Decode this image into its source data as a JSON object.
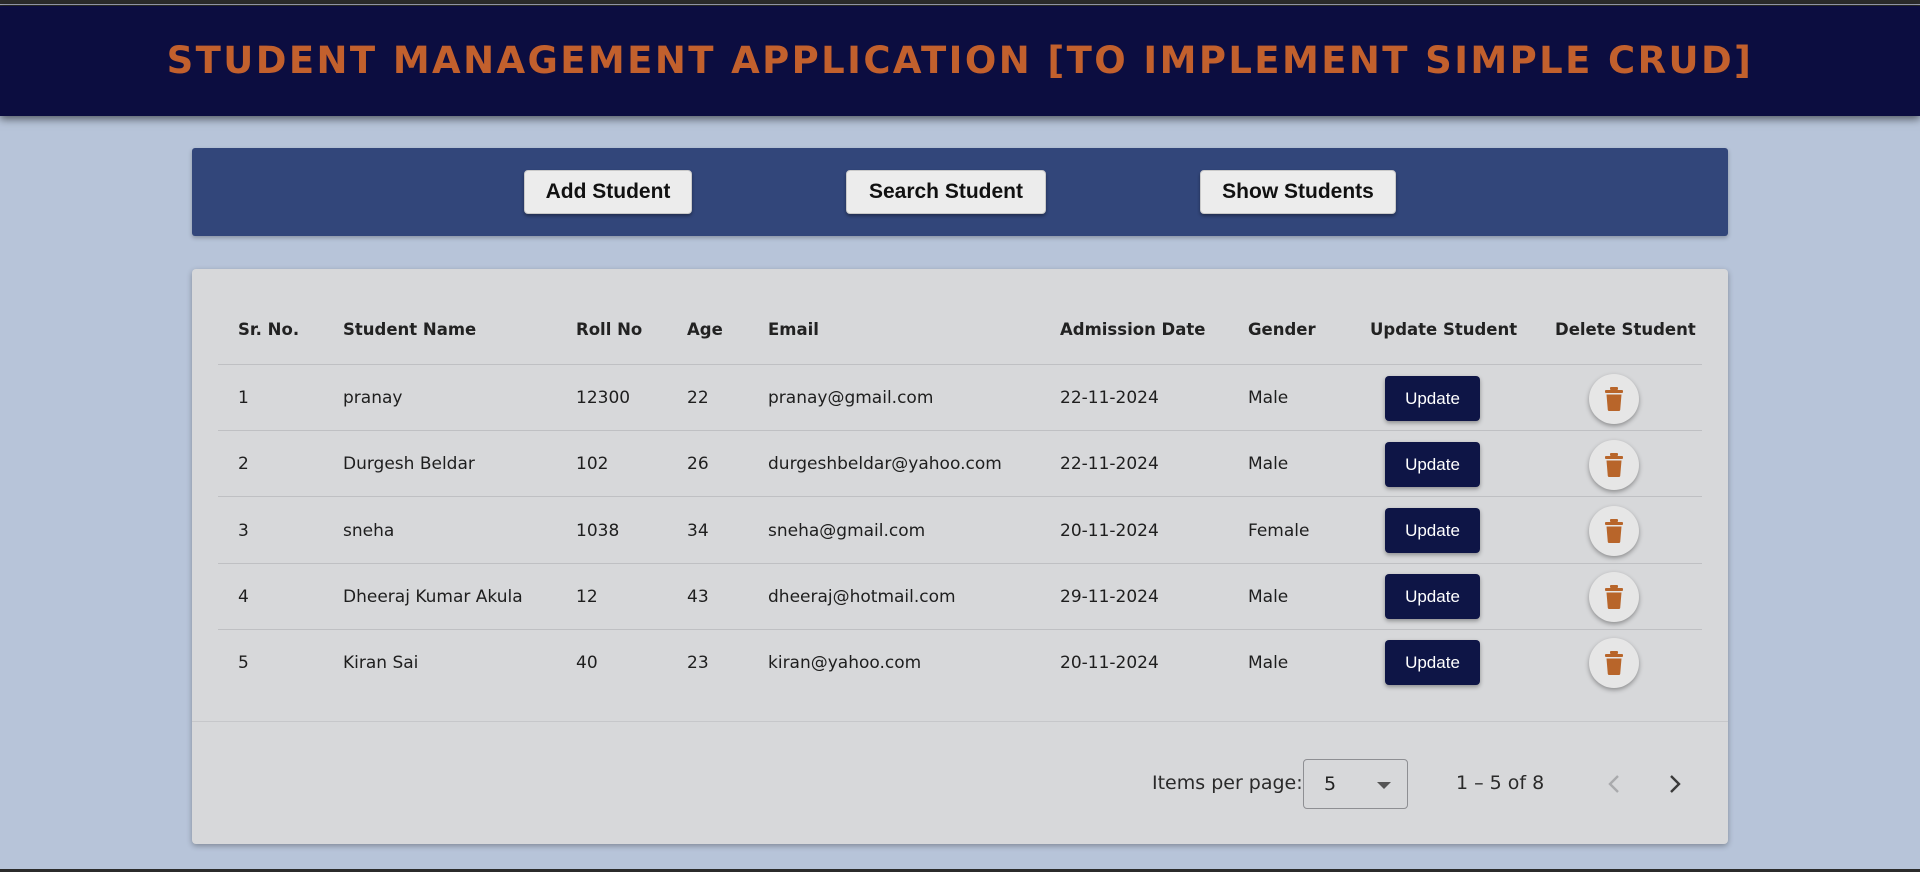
{
  "header": {
    "title": "STUDENT MANAGEMENT APPLICATION [TO IMPLEMENT SIMPLE CRUD]"
  },
  "toolbar": {
    "add_label": "Add Student",
    "search_label": "Search Student",
    "show_label": "Show Students"
  },
  "table": {
    "columns": [
      "Sr. No.",
      "Student Name",
      "Roll No",
      "Age",
      "Email",
      "Admission Date",
      "Gender",
      "Update Student",
      "Delete Student"
    ],
    "rows": [
      {
        "sr": "1",
        "name": "pranay",
        "roll": "12300",
        "age": "22",
        "email": "pranay@gmail.com",
        "date": "22-11-2024",
        "gender": "Male",
        "update": "Update"
      },
      {
        "sr": "2",
        "name": "Durgesh Beldar",
        "roll": "102",
        "age": "26",
        "email": "durgeshbeldar@yahoo.com",
        "date": "22-11-2024",
        "gender": "Male",
        "update": "Update"
      },
      {
        "sr": "3",
        "name": "sneha",
        "roll": "1038",
        "age": "34",
        "email": "sneha@gmail.com",
        "date": "20-11-2024",
        "gender": "Female",
        "update": "Update"
      },
      {
        "sr": "4",
        "name": "Dheeraj Kumar Akula",
        "roll": "12",
        "age": "43",
        "email": "dheeraj@hotmail.com",
        "date": "29-11-2024",
        "gender": "Male",
        "update": "Update"
      },
      {
        "sr": "5",
        "name": "Kiran Sai",
        "roll": "40",
        "age": "23",
        "email": "kiran@yahoo.com",
        "date": "20-11-2024",
        "gender": "Male",
        "update": "Update"
      }
    ]
  },
  "paginator": {
    "items_per_page_label": "Items per page:",
    "page_size": "5",
    "range_label": "1 – 5 of 8",
    "prev_icon": "chevron-left-icon",
    "next_icon": "chevron-right-icon"
  },
  "colors": {
    "header_bg": "#0c0d40",
    "title_color": "#c2602d",
    "toolbar_bg": "#32467a",
    "update_button_bg": "#0e1546",
    "delete_icon_color": "#b8652a",
    "page_bg": "#b7c4d9"
  }
}
